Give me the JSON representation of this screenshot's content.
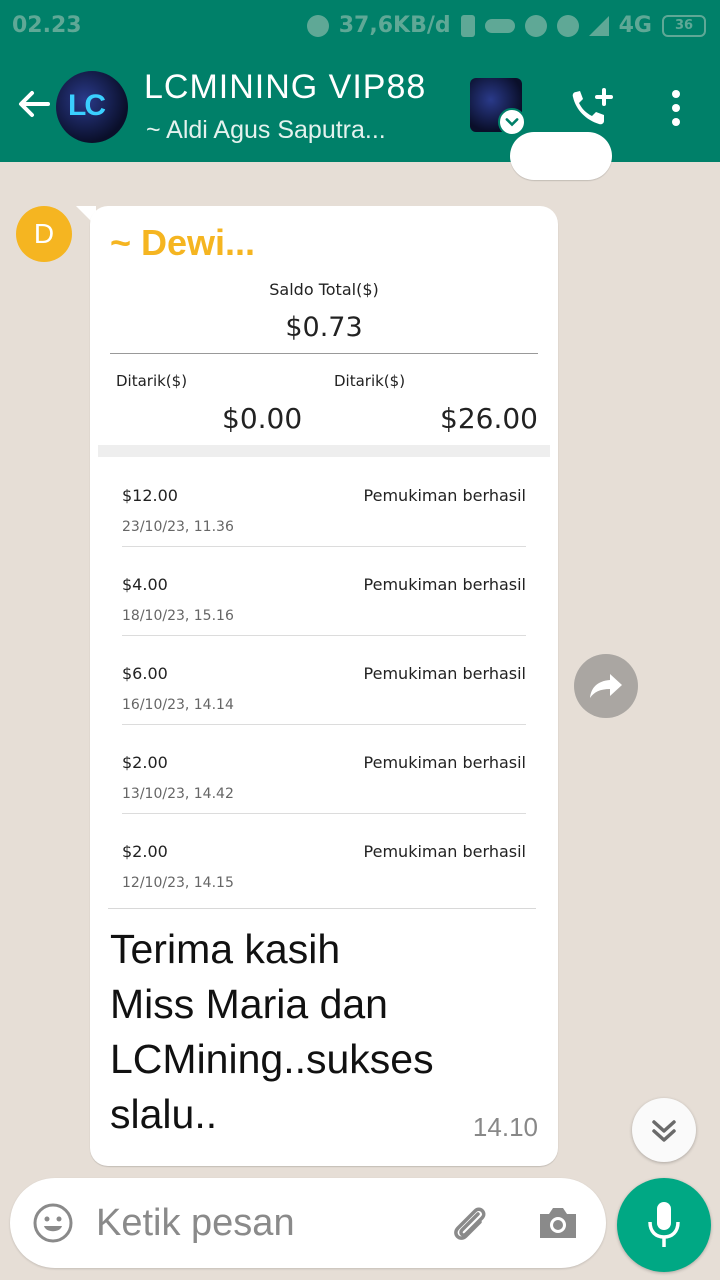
{
  "status_bar": {
    "time": "02.23",
    "network_speed": "37,6KB/d",
    "network_type": "4G",
    "battery": "36"
  },
  "header": {
    "title": "LCMINING VIP88",
    "subtitle": "~ Aldi Agus Saputra...",
    "avatar_text": "LC"
  },
  "message": {
    "sender_initial": "D",
    "sender_name": "~ Dewi...",
    "time": "14.10",
    "text_lines": [
      "Terima kasih",
      "Miss Maria dan",
      "LCMining..sukses",
      "slalu.."
    ],
    "screenshot": {
      "saldo_label": "Saldo Total($)",
      "saldo_value": "$0.73",
      "withdraw_label_1": "Ditarik($)",
      "withdraw_value_1": "$0.00",
      "withdraw_label_2": "Ditarik($)",
      "withdraw_value_2": "$26.00",
      "transactions": [
        {
          "amount": "$12.00",
          "status": "Pemukiman berhasil",
          "date": "23/10/23, 11.36"
        },
        {
          "amount": "$4.00",
          "status": "Pemukiman berhasil",
          "date": "18/10/23, 15.16"
        },
        {
          "amount": "$6.00",
          "status": "Pemukiman berhasil",
          "date": "16/10/23, 14.14"
        },
        {
          "amount": "$2.00",
          "status": "Pemukiman berhasil",
          "date": "13/10/23, 14.42"
        },
        {
          "amount": "$2.00",
          "status": "Pemukiman berhasil",
          "date": "12/10/23, 14.15"
        }
      ]
    }
  },
  "input": {
    "placeholder": "Ketik pesan"
  },
  "colors": {
    "header": "#008069",
    "accent": "#00a884",
    "sender_name": "#f5b521",
    "background": "#e6ded6"
  },
  "icons": {
    "back": "arrow-left-icon",
    "call": "add-call-icon",
    "menu": "more-vert-icon",
    "forward": "forward-icon",
    "scroll_down": "double-chevron-down-icon",
    "emoji": "emoji-icon",
    "attach": "paperclip-icon",
    "camera": "camera-icon",
    "mic": "mic-icon"
  }
}
